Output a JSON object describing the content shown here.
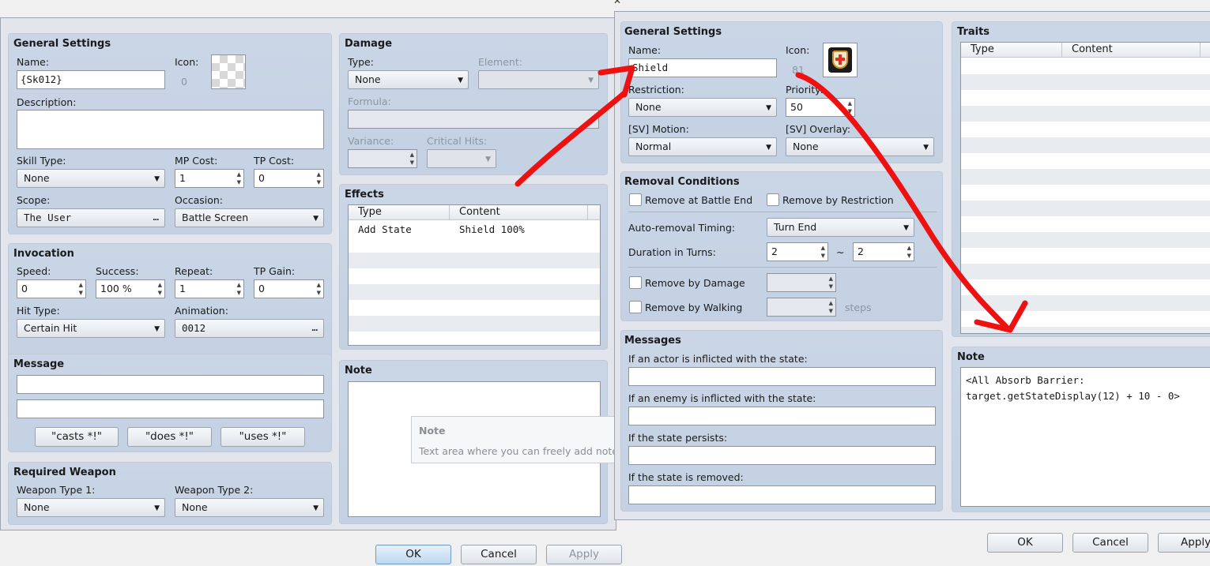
{
  "left": {
    "general": {
      "title": "General Settings",
      "name_label": "Name:",
      "name_value": "{Sk012}",
      "icon_label": "Icon:",
      "icon_index": "0",
      "description_label": "Description:",
      "skill_type_label": "Skill Type:",
      "skill_type": "None",
      "mp_cost_label": "MP Cost:",
      "mp_cost": "1",
      "tp_cost_label": "TP Cost:",
      "tp_cost": "0",
      "scope_label": "Scope:",
      "scope": "The User",
      "occasion_label": "Occasion:",
      "occasion": "Battle Screen"
    },
    "invocation": {
      "title": "Invocation",
      "speed_label": "Speed:",
      "speed": "0",
      "success_label": "Success:",
      "success": "100 %",
      "repeat_label": "Repeat:",
      "repeat": "1",
      "tp_gain_label": "TP Gain:",
      "tp_gain": "0",
      "hit_type_label": "Hit Type:",
      "hit_type": "Certain Hit",
      "animation_label": "Animation:",
      "animation": "0012"
    },
    "message": {
      "title": "Message",
      "btn_casts": "\"casts *!\"",
      "btn_does": "\"does *!\"",
      "btn_uses": "\"uses *!\""
    },
    "required_weapon": {
      "title": "Required Weapon",
      "wt1_label": "Weapon Type 1:",
      "wt1": "None",
      "wt2_label": "Weapon Type 2:",
      "wt2": "None"
    },
    "damage": {
      "title": "Damage",
      "type_label": "Type:",
      "type": "None",
      "element_label": "Element:",
      "formula_label": "Formula:",
      "variance_label": "Variance:",
      "critical_label": "Critical Hits:"
    },
    "effects": {
      "title": "Effects",
      "col_type": "Type",
      "col_content": "Content",
      "rows": [
        {
          "type": "Add State",
          "content": "Shield 100%"
        }
      ]
    },
    "note": {
      "title": "Note"
    },
    "tooltip": {
      "title": "Note",
      "text": "Text area where you can freely add note"
    },
    "buttons": {
      "ok": "OK",
      "cancel": "Cancel",
      "apply": "Apply"
    }
  },
  "right": {
    "general": {
      "title": "General Settings",
      "name_label": "Name:",
      "name_value": "Shield",
      "icon_label": "Icon:",
      "icon_index": "81",
      "restriction_label": "Restriction:",
      "restriction": "None",
      "priority_label": "Priority:",
      "priority": "50",
      "motion_label": "[SV] Motion:",
      "motion": "Normal",
      "overlay_label": "[SV] Overlay:",
      "overlay": "None"
    },
    "removal": {
      "title": "Removal Conditions",
      "battle_end": "Remove at Battle End",
      "by_restriction": "Remove by Restriction",
      "auto_timing_label": "Auto-removal Timing:",
      "auto_timing": "Turn End",
      "duration_label": "Duration in Turns:",
      "duration_min": "2",
      "tilde": "~",
      "duration_max": "2",
      "by_damage": "Remove by Damage",
      "by_walking": "Remove by Walking",
      "steps": "steps"
    },
    "messages": {
      "title": "Messages",
      "actor": "If an actor is inflicted with the state:",
      "enemy": "If an enemy is inflicted with the state:",
      "persists": "If the state persists:",
      "removed": "If the state is removed:"
    },
    "traits": {
      "title": "Traits",
      "col_type": "Type",
      "col_content": "Content"
    },
    "note": {
      "title": "Note",
      "line1": "<All Absorb Barrier:",
      "line2": "target.getStateDisplay(12) + 10 - 0>"
    },
    "buttons": {
      "ok": "OK",
      "cancel": "Cancel",
      "apply": "Apply"
    }
  },
  "colors": {
    "annotation_arrow": "#ee1111",
    "panel": "#c6d3e4",
    "window": "#e2e6ec"
  },
  "icons": {
    "state_icon": "shield-cross-icon",
    "close": "close-icon"
  }
}
